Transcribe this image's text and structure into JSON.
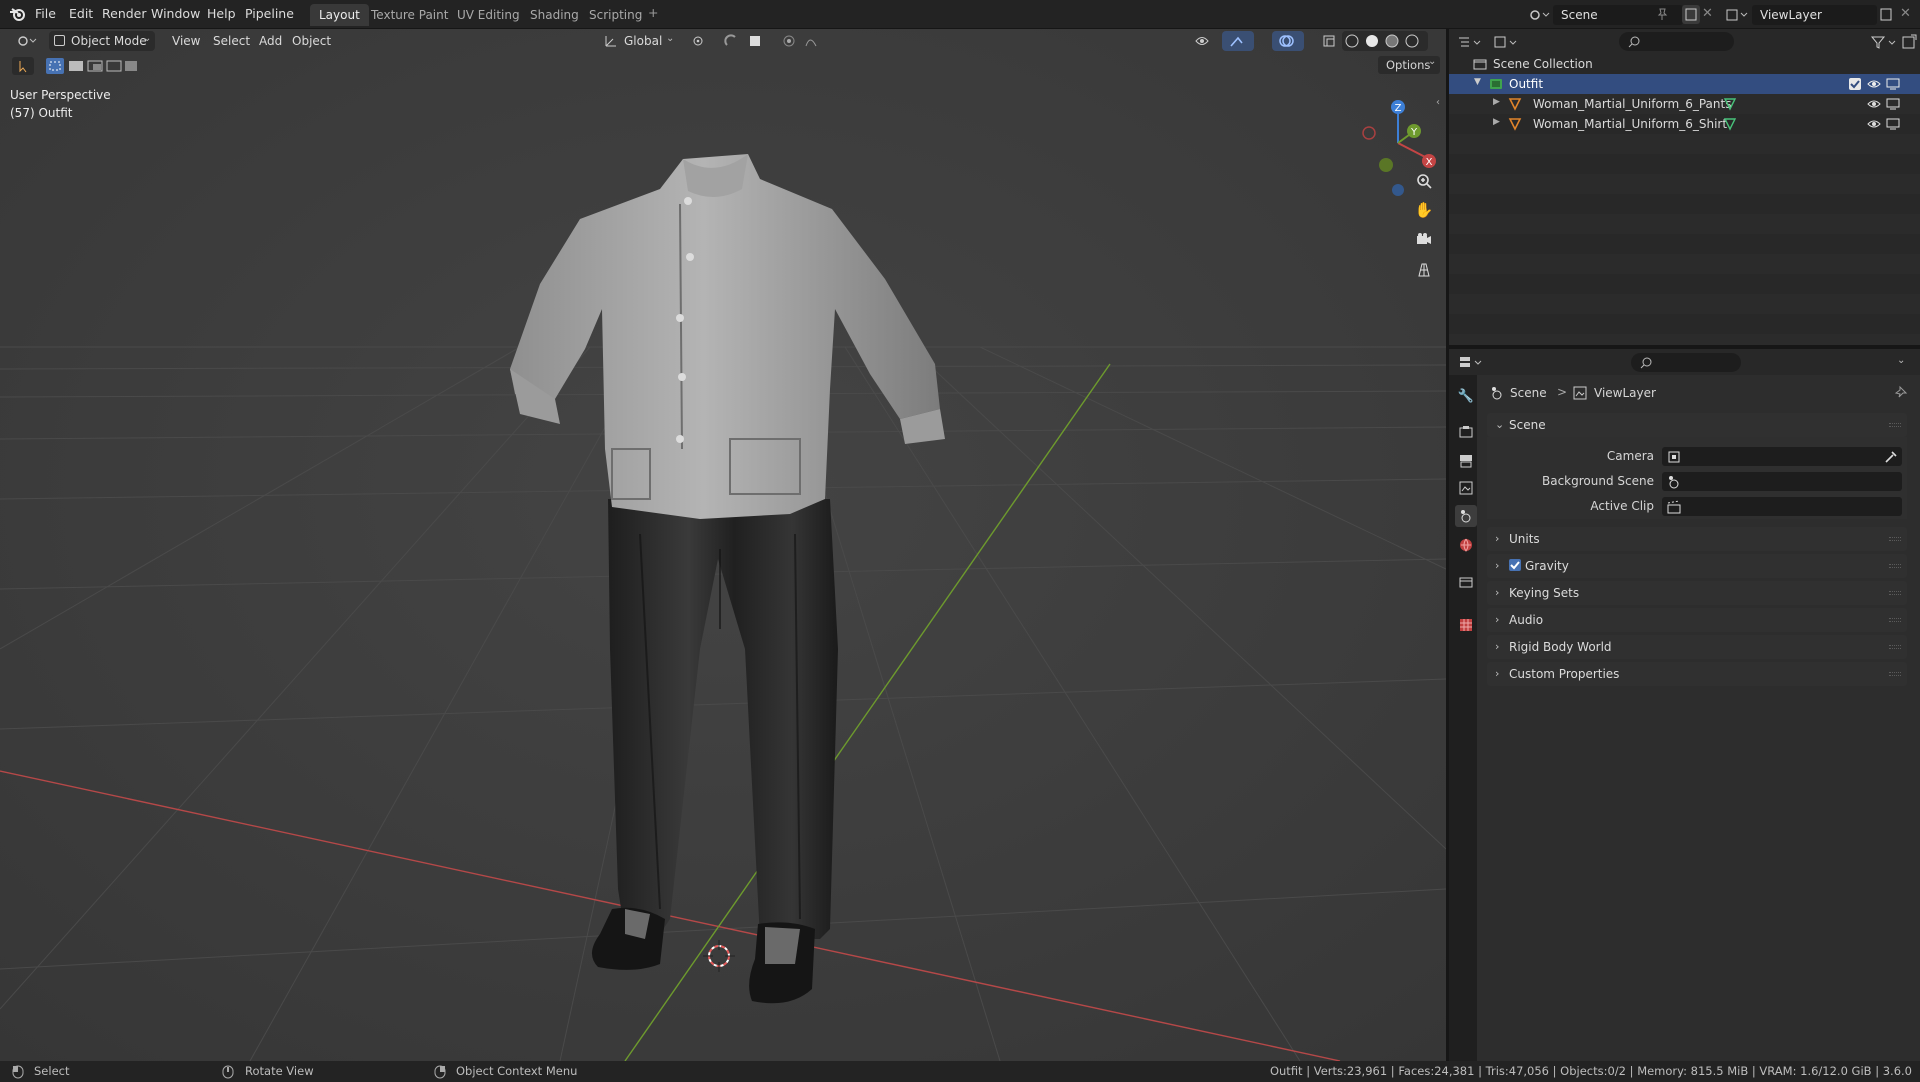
{
  "topbar": {
    "menus": [
      "File",
      "Edit",
      "Render",
      "Window",
      "Help",
      "Pipeline"
    ],
    "workspaces": [
      "Layout",
      "Texture Paint",
      "UV Editing",
      "Shading",
      "Scripting"
    ],
    "active_workspace": "Layout",
    "add_tab_symbol": "+",
    "scene_name": "Scene",
    "view_layer_name": "ViewLayer"
  },
  "viewport": {
    "mode": "Object Mode",
    "menus": [
      "View",
      "Select",
      "Add",
      "Object"
    ],
    "transform_orientation": "Global",
    "options_label": "Options",
    "info_line1": "User Perspective",
    "info_line2": "(57) Outfit",
    "gizmo_axes": {
      "x": "X",
      "y": "Y",
      "z": "Z"
    }
  },
  "outliner": {
    "root": "Scene Collection",
    "collection": "Outfit",
    "objects": [
      "Woman_Martial_Uniform_6_Pants",
      "Woman_Martial_Uniform_6_Shirt"
    ]
  },
  "properties": {
    "breadcrumb_scene": "Scene",
    "breadcrumb_separator": ">",
    "breadcrumb_layer": "ViewLayer",
    "panel_title": "Scene",
    "fields": {
      "camera_label": "Camera",
      "background_label": "Background Scene",
      "active_clip_label": "Active Clip"
    },
    "collapsed_panels": [
      "Units",
      "Gravity",
      "Keying Sets",
      "Audio",
      "Rigid Body World",
      "Custom Properties"
    ]
  },
  "statusbar": {
    "select": "Select",
    "rotate": "Rotate View",
    "context": "Object Context Menu",
    "stats": "Outfit | Verts:23,961 | Faces:24,381 | Tris:47,056 | Objects:0/2 | Memory: 815.5 MiB | VRAM: 1.6/12.0 GiB | 3.6.0"
  },
  "colors": {
    "accent_blue": "#4772b3",
    "x_axis": "#c44545",
    "y_axis": "#6e9a2e",
    "z_axis": "#3d7fd6",
    "selection_row": "#334d80"
  }
}
